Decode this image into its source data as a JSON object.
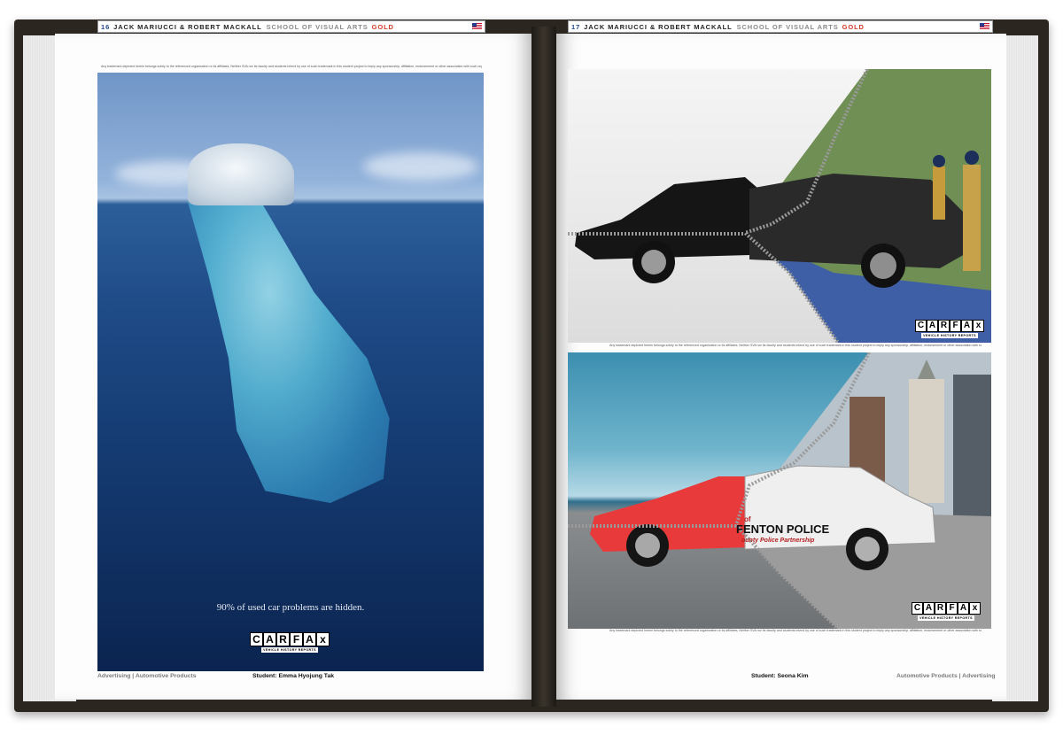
{
  "left_page": {
    "page_number": "16",
    "header_names": "JACK MARIUCCI & ROBERT MACKALL",
    "school": "SCHOOL OF VISUAL ARTS",
    "award": "GOLD",
    "disclaimer": "Any trademark depicted herein belongs solely to the referenced organization or its affiliates. Neither SVA nor its faculty and students intend by use of such trademark in this student project to imply any sponsorship, affiliation, endorsement or other association with such organization.",
    "ad": {
      "tagline": "90% of used car problems are hidden.",
      "logo_letters": [
        "C",
        "A",
        "R",
        "F",
        "A",
        "x"
      ],
      "logo_sub": "VEHICLE HISTORY REPORTS"
    },
    "footer_category": "Advertising | Automotive Products",
    "footer_student": "Student: Emma Hyojung Tak"
  },
  "right_page": {
    "page_number": "17",
    "header_names": "JACK MARIUCCI & ROBERT MACKALL",
    "school": "SCHOOL OF VISUAL ARTS",
    "award": "GOLD",
    "ad_top": {
      "logo_letters": [
        "C",
        "A",
        "R",
        "F",
        "A",
        "x"
      ],
      "logo_sub": "VEHICLE HISTORY REPORTS",
      "disclaimer": "Any trademark depicted herein belongs solely to the referenced organization or its affiliates. Neither SVA nor its faculty and students intend by use of such trademark in this student project to imply any sponsorship, affiliation, endorsement or other association with such organization."
    },
    "ad_bottom": {
      "car_text_small": "of",
      "car_text_main": "FENTON POLICE",
      "car_text_sub": "ounty Police Partnership",
      "logo_letters": [
        "C",
        "A",
        "R",
        "F",
        "A",
        "x"
      ],
      "logo_sub": "VEHICLE HISTORY REPORTS",
      "disclaimer": "Any trademark depicted herein belongs solely to the referenced organization or its affiliates. Neither SVA nor its faculty and students intend by use of such trademark in this student project to imply any sponsorship, affiliation, endorsement or other association with such organization."
    },
    "footer_student": "Student: Seona Kim",
    "footer_category": "Automotive Products | Advertising"
  },
  "colors": {
    "page_number": "#1f4a8a",
    "award": "#d43a2a",
    "cover": "#2b2620"
  }
}
